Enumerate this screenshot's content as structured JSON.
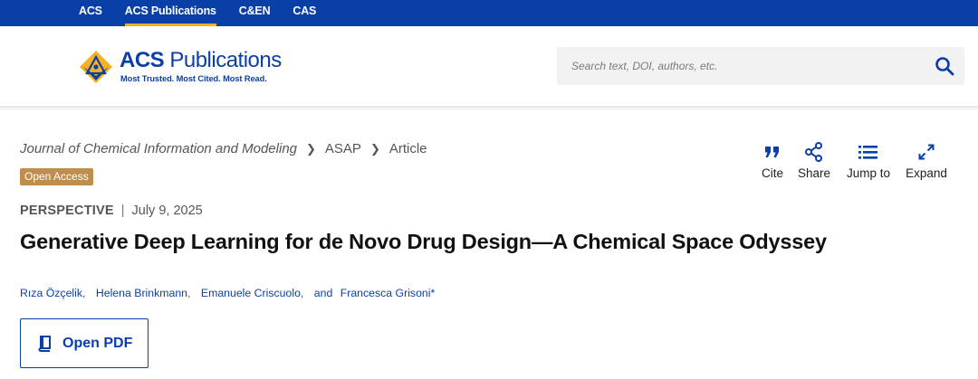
{
  "topnav": {
    "items": [
      {
        "label": "ACS",
        "active": false
      },
      {
        "label": "ACS Publications",
        "active": true
      },
      {
        "label": "C&EN",
        "active": false
      },
      {
        "label": "CAS",
        "active": false
      }
    ]
  },
  "logo": {
    "brand_bold": "ACS",
    "brand_rest": "Publications",
    "tagline": "Most Trusted. Most Cited. Most Read."
  },
  "search": {
    "placeholder": "Search text, DOI, authors, etc."
  },
  "breadcrumb": {
    "journal": "Journal of Chemical Information and Modeling",
    "section": "ASAP",
    "page": "Article"
  },
  "badge": {
    "open_access": "Open Access"
  },
  "tools": {
    "cite": "Cite",
    "share": "Share",
    "jump_to": "Jump to",
    "expand": "Expand"
  },
  "article": {
    "type": "PERSPECTIVE",
    "date": "July 9, 2025",
    "title": "Generative Deep Learning for de Novo Drug Design—A Chemical Space Odyssey",
    "authors": [
      "Rıza Özçelik",
      "Helena Brinkmann",
      "Emanuele Criscuolo",
      "Francesca Grisoni*"
    ],
    "and": "and"
  },
  "actions": {
    "open_pdf": "Open PDF"
  },
  "colors": {
    "brand_blue": "#0a3fa8",
    "active_underline": "#f4b223",
    "badge_gold": "#c08e4a"
  }
}
